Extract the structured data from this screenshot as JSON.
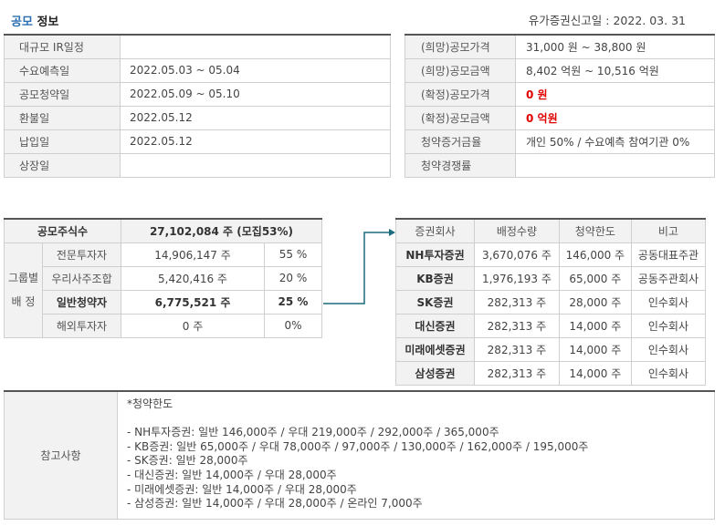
{
  "header": {
    "title_accent": "공모",
    "title_rest": "정보",
    "report_date_label": "유가증권신고일 :",
    "report_date": "2022. 03. 31"
  },
  "schedule": [
    {
      "label": "대규모 IR일정",
      "value": ""
    },
    {
      "label": "수요예측일",
      "value": "2022.05.03 ~ 05.04"
    },
    {
      "label": "공모청약일",
      "value": "2022.05.09 ~ 05.10"
    },
    {
      "label": "환불일",
      "value": "2022.05.12"
    },
    {
      "label": "납입일",
      "value": "2022.05.12"
    },
    {
      "label": "상장일",
      "value": ""
    }
  ],
  "pricing": [
    {
      "label": "(희망)공모가격",
      "value": "31,000 원 ~ 38,800 원"
    },
    {
      "label": "(희망)공모금액",
      "value": "8,402 억원   ~  10,516 억원"
    },
    {
      "label": "(확정)공모가격",
      "value": "0 원"
    },
    {
      "label": "(확정)공모금액",
      "value": "0 억원"
    },
    {
      "label": "청약증거금율",
      "value": "개인 50% / 수요예측 참여기관 0%"
    },
    {
      "label": "청약경쟁률",
      "value": ""
    }
  ],
  "shares": {
    "total_label": "공모주식수",
    "total_value": "27,102,084  주 (모집53%)",
    "group_label_1": "그룹별",
    "group_label_2": "배 정",
    "rows": [
      {
        "category": "전문투자자",
        "shares": "14,906,147 주",
        "pct": "55 %"
      },
      {
        "category": "우리사주조합",
        "shares": "5,420,416 주",
        "pct": "20 %"
      },
      {
        "category": "일반청약자",
        "shares": "6,775,521  주",
        "pct": "25  %"
      },
      {
        "category": "해외투자자",
        "shares": "0 주",
        "pct": "0%"
      }
    ]
  },
  "underwriters": {
    "headers": [
      "증권회사",
      "배정수량",
      "청약한도",
      "비고"
    ],
    "rows": [
      {
        "firm": "NH투자증권",
        "qty": "3,670,076 주",
        "limit": "146,000 주",
        "note": "공동대표주관"
      },
      {
        "firm": "KB증권",
        "qty": "1,976,193 주",
        "limit": "65,000 주",
        "note": "공동주관회사"
      },
      {
        "firm": "SK증권",
        "qty": "282,313 주",
        "limit": "28,000 주",
        "note": "인수회사"
      },
      {
        "firm": "대신증권",
        "qty": "282,313 주",
        "limit": "14,000 주",
        "note": "인수회사"
      },
      {
        "firm": "미래에셋증권",
        "qty": "282,313 주",
        "limit": "14,000 주",
        "note": "인수회사"
      },
      {
        "firm": "삼성증권",
        "qty": "282,313 주",
        "limit": "14,000 주",
        "note": "인수회사"
      }
    ]
  },
  "notes": {
    "label": "참고사항",
    "heading": "*청약한도",
    "lines": [
      "- NH투자증권: 일반 146,000주 / 우대 219,000주 / 292,000주 / 365,000주",
      "- KB증권: 일반 65,000주 / 우대 78,000주 / 97,000주 / 130,000주 / 162,000주 / 195,000주",
      "- SK증권: 일반 28,000주",
      "- 대신증권: 일반 14,000주 / 우대 28,000주",
      "- 미래에셋증권: 일반 14,000주 / 우대 28,000주",
      "- 삼성증권: 일반 14,000주 / 우대 28,000주 / 온라인 7,000주"
    ]
  }
}
